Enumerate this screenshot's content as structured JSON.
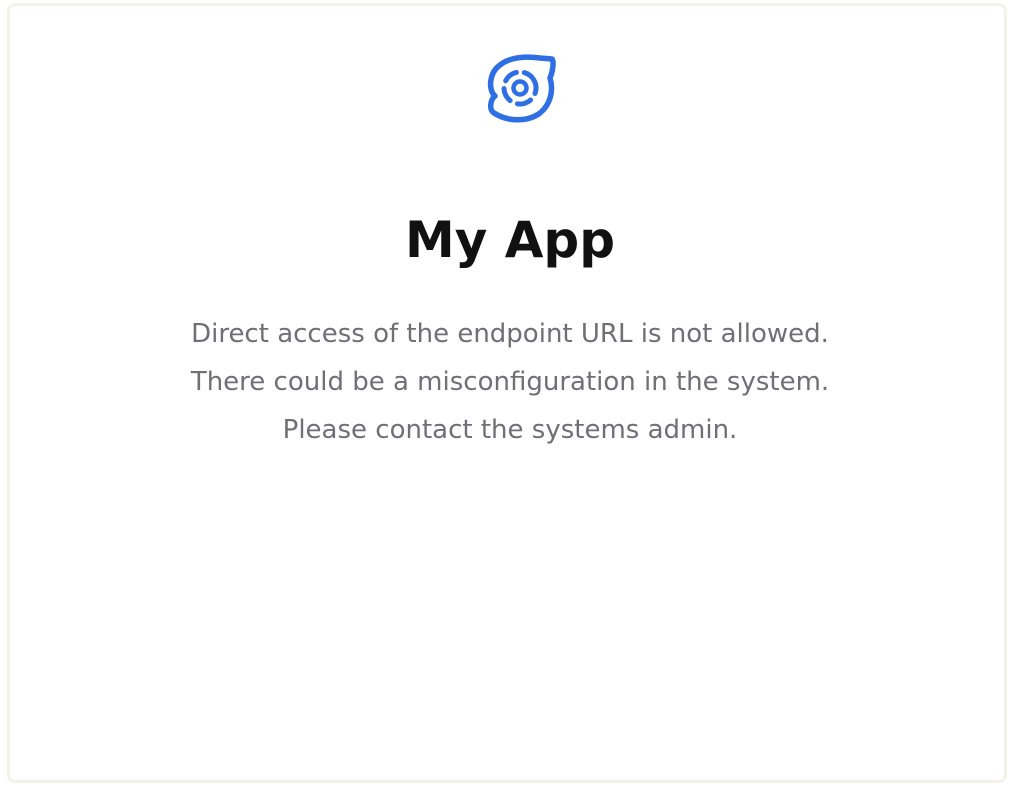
{
  "app": {
    "title": "My App",
    "logo_icon": "blue-orbit-speech-bubble-icon"
  },
  "error": {
    "message": "Direct access of the endpoint URL is not allowed. There could be a misconfiguration in the system. Please contact the systems admin."
  },
  "colors": {
    "accent": "#2f6fe4",
    "title": "#111111",
    "message": "#6f6f76",
    "frame_border": "#f3f2e7",
    "background": "#ffffff"
  }
}
